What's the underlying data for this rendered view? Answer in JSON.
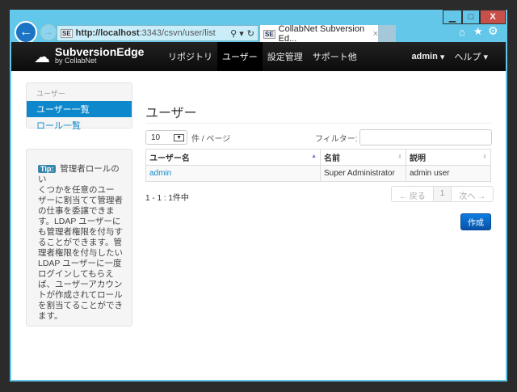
{
  "browser": {
    "url_host": "http://localhost",
    "url_path": ":3343/csvn/user/list",
    "tab_title": "CollabNet Subversion Ed...",
    "favicon": "SE"
  },
  "window_controls": {
    "minimize": "▁",
    "maximize": "□",
    "close": "X"
  },
  "navbar": {
    "brand": "SubversionEdge",
    "brand_sub": "by CollabNet",
    "items": [
      {
        "label": "リポジトリ"
      },
      {
        "label": "ユーザー",
        "active": true
      },
      {
        "label": "設定管理"
      },
      {
        "label": "サポート他"
      }
    ],
    "user_menu": "admin",
    "help_menu": "ヘルプ"
  },
  "sidebar": {
    "heading": "ユーザー",
    "items": [
      {
        "label": "ユーザー一覧",
        "active": true
      },
      {
        "label": "ロール一覧"
      }
    ]
  },
  "tip": {
    "badge": "Tip:",
    "lines": [
      "管理者ロールのい",
      "くつかを任意のユー",
      "ザーに割当てて管理者",
      "の仕事を委譲できま",
      "す。LDAP ユーザーに",
      "も管理者権限を付与す",
      "ることができます。管",
      "理者権限を付与したい",
      "LDAP ユーザーに一度",
      "ログインしてもらえ",
      "ば、ユーザーアカウン",
      "トが作成されてロール",
      "を割当てることができ",
      "ます。"
    ]
  },
  "main": {
    "title": "ユーザー",
    "page_size": "10",
    "page_size_label": "件 / ページ",
    "filter_label": "フィルター:",
    "filter_value": "",
    "columns": [
      "ユーザー名",
      "名前",
      "説明"
    ],
    "rows": [
      {
        "username": "admin",
        "name": "Super Administrator",
        "description": "admin user"
      }
    ],
    "summary": "1 - 1 : 1件中",
    "pager": {
      "prev": "← 戻る",
      "page": "1",
      "next": "次へ →"
    },
    "create_button": "作成"
  },
  "colors": {
    "accent": "#0e88cc",
    "navbar": "#111111",
    "button": "#0b5fb8"
  }
}
